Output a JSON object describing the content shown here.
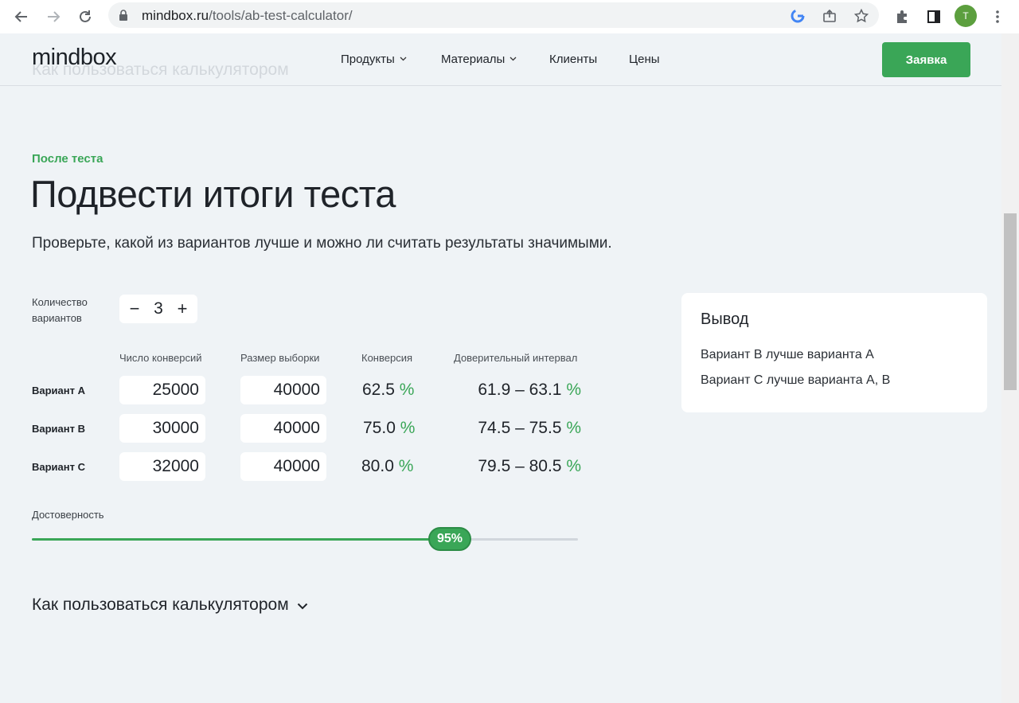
{
  "browser": {
    "url_host": "mindbox.ru",
    "url_path": "/tools/ab-test-calculator/",
    "avatar_letter": "T"
  },
  "header": {
    "logo": "mindbox",
    "ghost_text": "Как пользоваться калькулятором",
    "menu": [
      {
        "label": "Продукты",
        "has_dropdown": true
      },
      {
        "label": "Материалы",
        "has_dropdown": true
      },
      {
        "label": "Клиенты",
        "has_dropdown": false
      },
      {
        "label": "Цены",
        "has_dropdown": false
      }
    ],
    "cta_label": "Заявка",
    "accent_color": "#3aa657"
  },
  "section": {
    "eyebrow": "После теста",
    "title": "Подвести итоги теста",
    "lead": "Проверьте, какой из вариантов лучше и можно ли считать результаты значимыми."
  },
  "calculator": {
    "variants_count_label": "Количество вариантов",
    "variants_count": "3",
    "minus": "−",
    "plus": "+",
    "columns": [
      "Число конверсий",
      "Размер выборки",
      "Конверсия",
      "Доверительный интервал"
    ],
    "percent_sign": "%",
    "rows": [
      {
        "label": "Вариант А",
        "conversions": "25000",
        "sample": "40000",
        "conversion": "62.5",
        "interval": "61.9 – 63.1"
      },
      {
        "label": "Вариант В",
        "conversions": "30000",
        "sample": "40000",
        "conversion": "75.0",
        "interval": "74.5 – 75.5"
      },
      {
        "label": "Вариант С",
        "conversions": "32000",
        "sample": "40000",
        "conversion": "80.0",
        "interval": "79.5 – 80.5"
      }
    ],
    "confidence_label": "Достоверность",
    "confidence_value": "95%",
    "confidence_fill_fraction": 0.766
  },
  "result": {
    "title": "Вывод",
    "lines": [
      "Вариант В лучше варианта А",
      "Вариант С лучше варианта А, В"
    ]
  },
  "howto": {
    "label": "Как пользоваться калькулятором"
  }
}
